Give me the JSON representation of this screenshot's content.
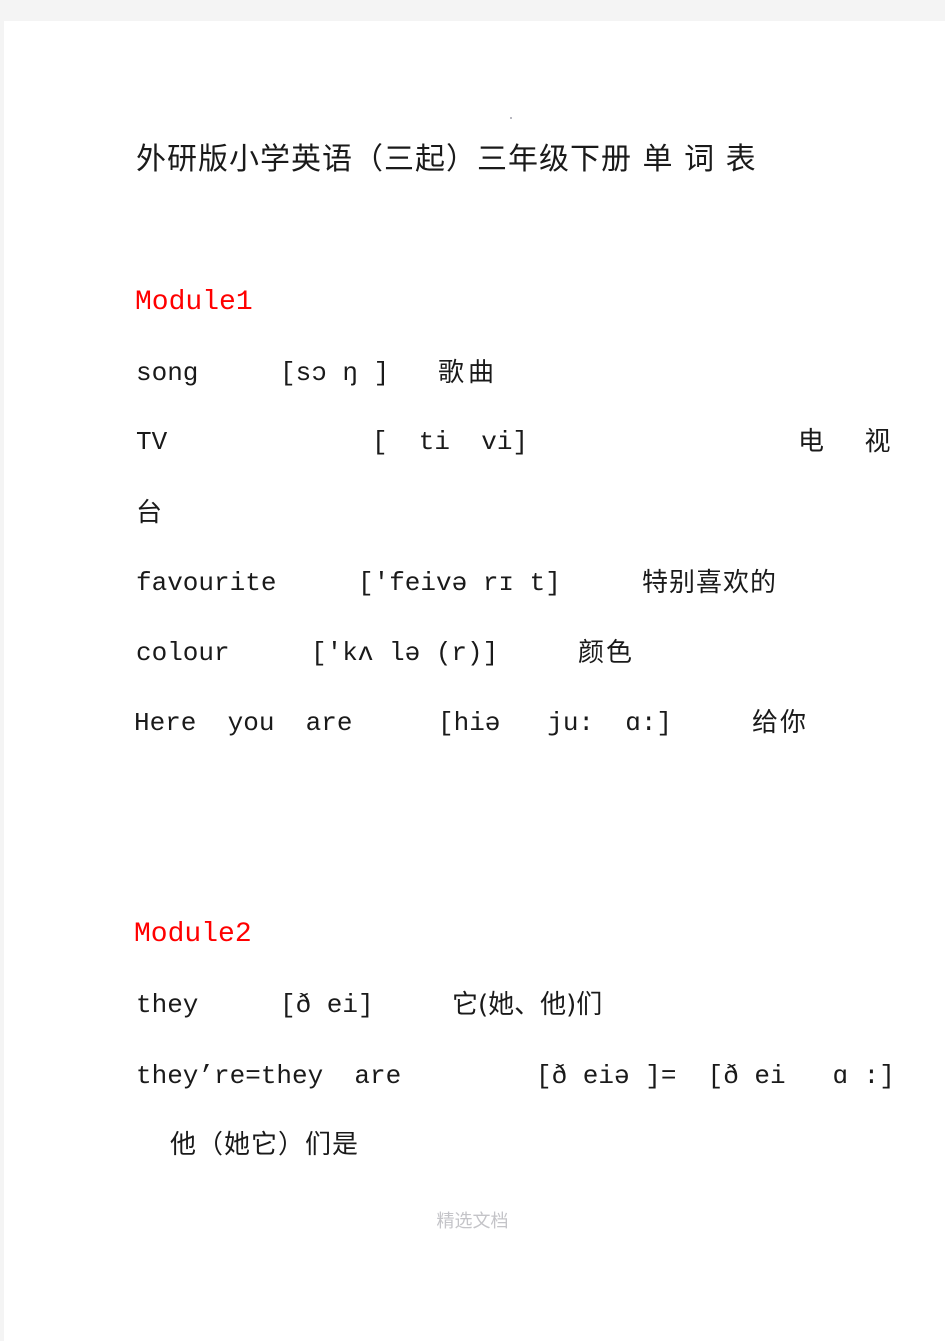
{
  "document": {
    "title": "外研版小学英语（三起）三年级下册 单 词 表",
    "footer": "精选文档",
    "accent_color": "#ff0000",
    "modules": [
      {
        "heading": "Module1",
        "entries": [
          {
            "word": "song",
            "phonetic": "[sɔ ŋ ]",
            "meaning": "歌曲"
          },
          {
            "word": "TV",
            "phonetic": "[  ti  vi]",
            "meaning": "电  视",
            "meaning_wrap": "台"
          },
          {
            "word": "favourite",
            "phonetic": "['feivə rɪ t]",
            "meaning": "特别喜欢的"
          },
          {
            "word": "colour",
            "phonetic": "['kʌ lə (r)]",
            "meaning": "颜色"
          },
          {
            "word": "Here  you  are",
            "phonetic": "[hiə   ju:  ɑ:]",
            "meaning": "给你"
          }
        ]
      },
      {
        "heading": "Module2",
        "entries": [
          {
            "word": "they",
            "phonetic": "[ð ei]",
            "meaning": "它(她、他)们"
          },
          {
            "word": "they’re=they  are",
            "phonetic": "[ð eiə ]=  [ð ei   ɑ :]",
            "meaning": "他（她它）们是"
          }
        ]
      }
    ]
  }
}
